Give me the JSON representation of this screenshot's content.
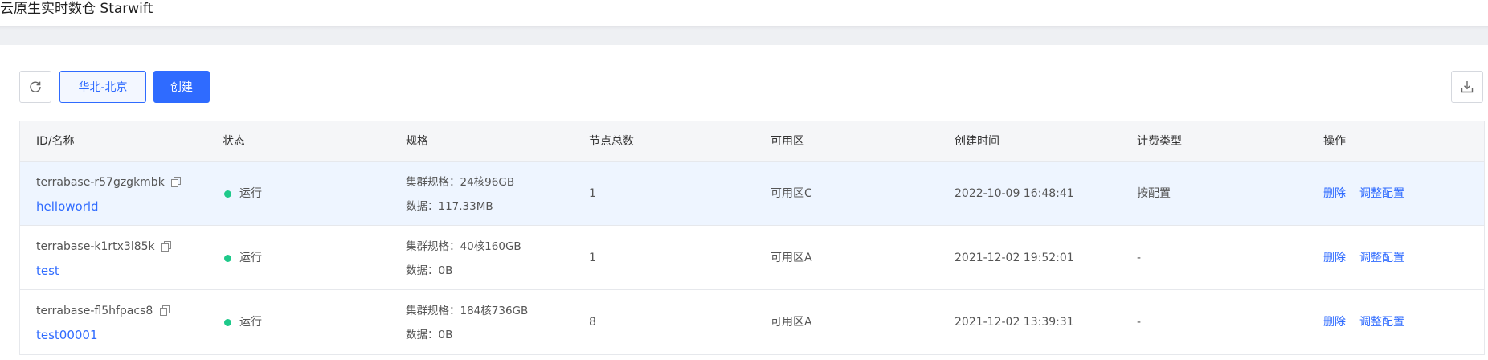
{
  "app": {
    "title": "云原生实时数仓 Starwift"
  },
  "toolbar": {
    "refresh_icon": "refresh-icon",
    "region_label": "华北-北京",
    "create_label": "创建",
    "download_icon": "download-icon",
    "accent_color": "#2f6bff"
  },
  "table": {
    "headers": {
      "id_name": "ID/名称",
      "status": "状态",
      "spec": "规格",
      "nodes": "节点总数",
      "zone": "可用区",
      "created": "创建时间",
      "billing": "计费类型",
      "actions": "操作"
    },
    "rows": [
      {
        "id": "terrabase-r57gzgkmbk",
        "name": "helloworld",
        "status": "运行",
        "spec_cluster": "集群规格：24核96GB",
        "spec_data": "数据：117.33MB",
        "nodes": "1",
        "zone": "可用区C",
        "created": "2022-10-09 16:48:41",
        "billing": "按配置",
        "action_delete": "删除",
        "action_adjust": "调整配置"
      },
      {
        "id": "terrabase-k1rtx3l85k",
        "name": "test",
        "status": "运行",
        "spec_cluster": "集群规格：40核160GB",
        "spec_data": "数据：0B",
        "nodes": "1",
        "zone": "可用区A",
        "created": "2021-12-02 19:52:01",
        "billing": "-",
        "action_delete": "删除",
        "action_adjust": "调整配置"
      },
      {
        "id": "terrabase-fl5hfpacs8",
        "name": "test00001",
        "status": "运行",
        "spec_cluster": "集群规格：184核736GB",
        "spec_data": "数据：0B",
        "nodes": "8",
        "zone": "可用区A",
        "created": "2021-12-02 13:39:31",
        "billing": "-",
        "action_delete": "删除",
        "action_adjust": "调整配置"
      }
    ],
    "status_color": "#1ec98a"
  }
}
